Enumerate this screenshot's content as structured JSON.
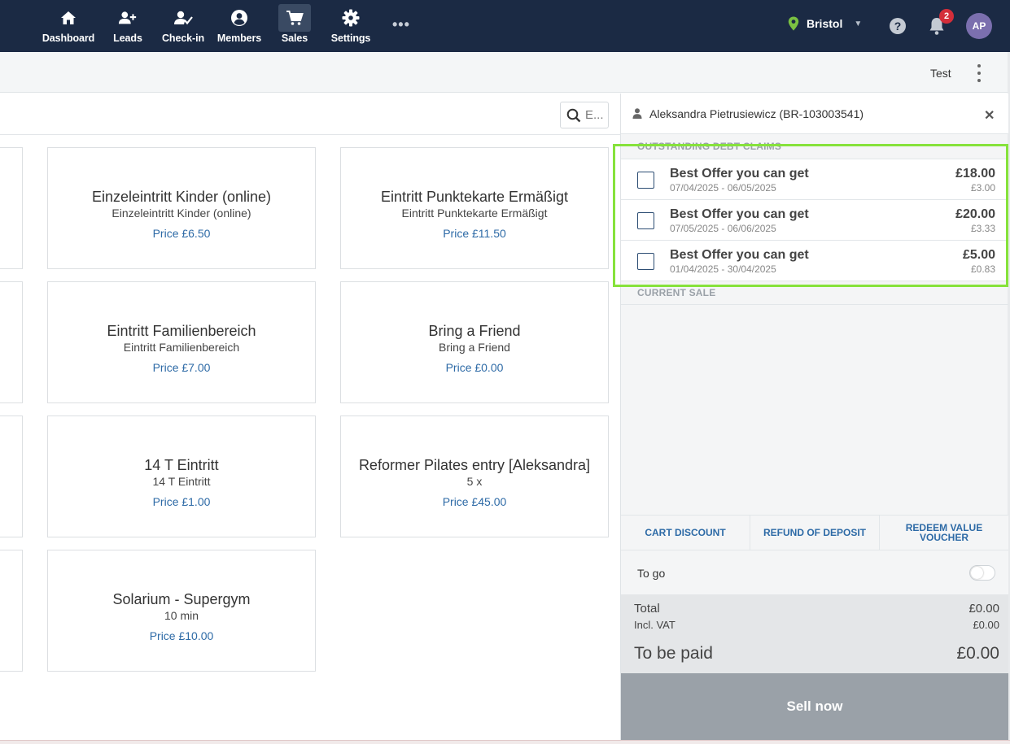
{
  "nav": {
    "items": [
      {
        "label": "Dashboard",
        "icon": "home-icon"
      },
      {
        "label": "Leads",
        "icon": "add-user-icon"
      },
      {
        "label": "Check-in",
        "icon": "check-in-icon"
      },
      {
        "label": "Members",
        "icon": "member-icon"
      },
      {
        "label": "Sales",
        "icon": "cart-icon",
        "active": true
      },
      {
        "label": "Settings",
        "icon": "gear-icon"
      }
    ],
    "more": "•••",
    "location": "Bristol",
    "notification_count": "2",
    "avatar_initials": "AP"
  },
  "subheader": {
    "label": "Test"
  },
  "search": {
    "placeholder": "E..."
  },
  "products": [
    {
      "title": "Einzeleintritt Kinder (online)",
      "subtitle": "Einzeleintritt Kinder (online)",
      "price": "Price £6.50"
    },
    {
      "title": "Eintritt Punktekarte Ermäßigt",
      "subtitle": "Eintritt Punktekarte Ermäßigt",
      "price": "Price £11.50"
    },
    {
      "title": "Eintritt Familienbereich",
      "subtitle": "Eintritt Familienbereich",
      "price": "Price £7.00"
    },
    {
      "title": "Bring a Friend",
      "subtitle": "Bring a Friend",
      "price": "Price £0.00"
    },
    {
      "title": "14 T Eintritt",
      "subtitle": "14 T Eintritt",
      "price": "Price £1.00"
    },
    {
      "title": "Reformer Pilates entry [Aleksandra]",
      "subtitle": "5 x",
      "price": "Price £45.00"
    },
    {
      "title": "Solarium - Supergym",
      "subtitle": "10 min",
      "price": "Price £10.00"
    }
  ],
  "cart": {
    "customer": "Aleksandra Pietrusiewicz (BR-103003541)",
    "debt_section_label": "OUTSTANDING DEBT CLAIMS",
    "debts": [
      {
        "name": "Best Offer you can get",
        "dates": "07/04/2025 - 06/05/2025",
        "amount": "£18.00",
        "sub_amount": "£3.00",
        "checked": false
      },
      {
        "name": "Best Offer you can get",
        "dates": "07/05/2025 - 06/06/2025",
        "amount": "£20.00",
        "sub_amount": "£3.33",
        "checked": false
      },
      {
        "name": "Best Offer you can get",
        "dates": "01/04/2025 - 30/04/2025",
        "amount": "£5.00",
        "sub_amount": "£0.83",
        "checked": false
      }
    ],
    "current_sale_label": "CURRENT SALE",
    "actions": {
      "cart_discount": "CART DISCOUNT",
      "refund_of_deposit": "REFUND OF DEPOSIT",
      "redeem_value_voucher": "REDEEM VALUE VOUCHER"
    },
    "to_go_label": "To go",
    "to_go_enabled": false,
    "total_label": "Total",
    "total_value": "£0.00",
    "vat_label": "Incl. VAT",
    "vat_value": "£0.00",
    "to_pay_label": "To be paid",
    "to_pay_value": "£0.00",
    "sell_label": "Sell now"
  },
  "colors": {
    "nav_bg": "#1b2a44",
    "accent_blue": "#2d6aa6",
    "highlight": "#86e23b",
    "badge": "#d42e3a",
    "location_pin": "#7ac142"
  }
}
